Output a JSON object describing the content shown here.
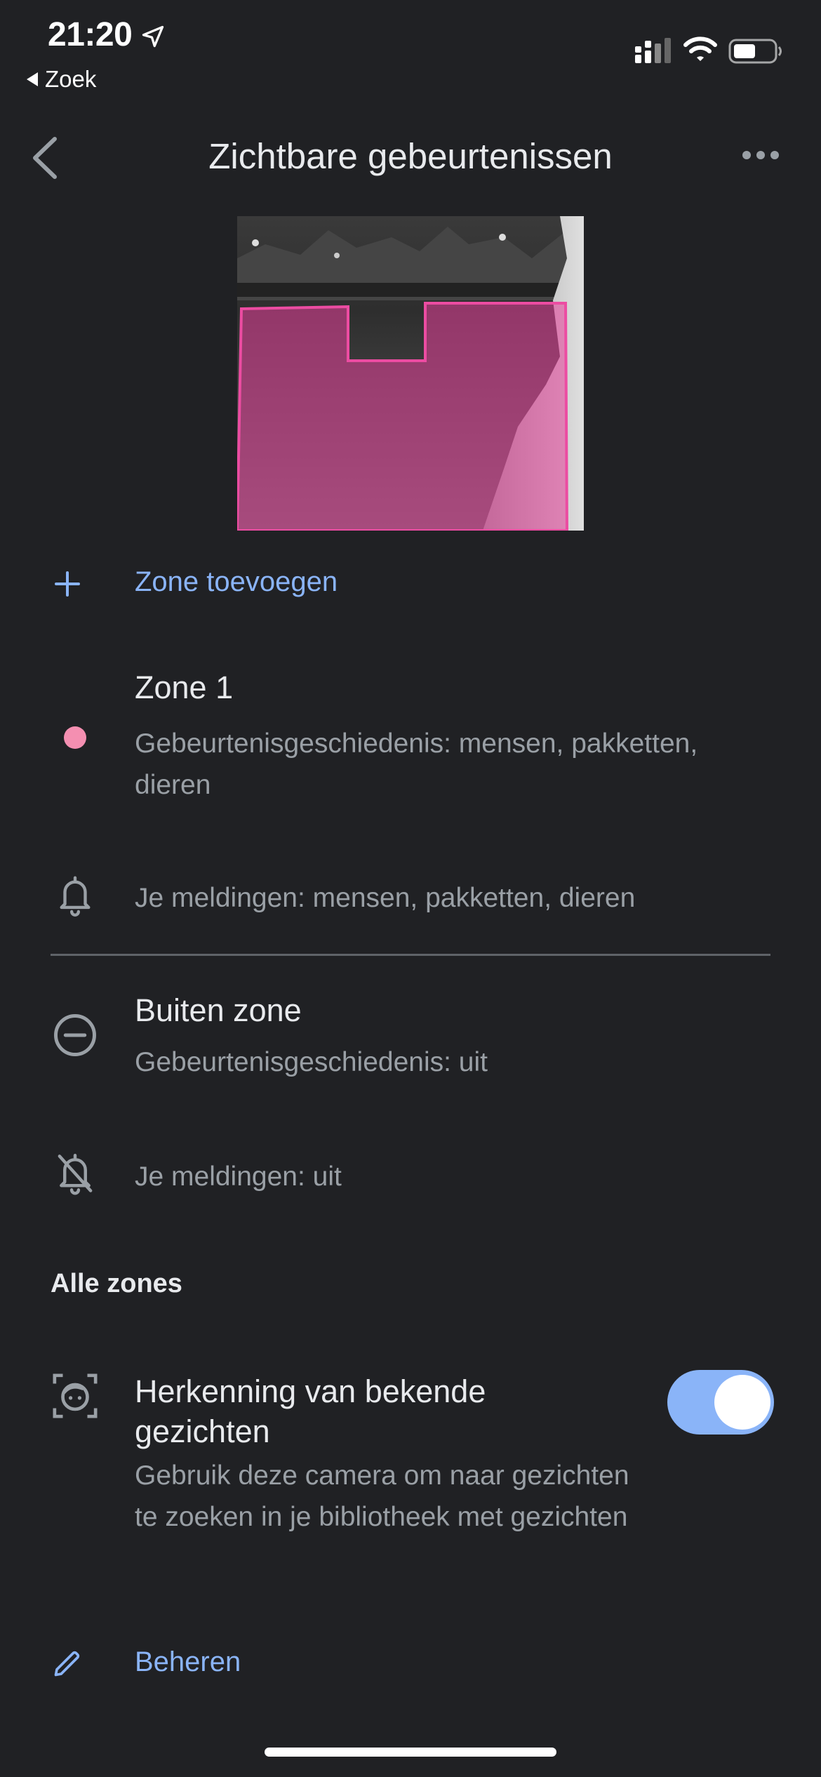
{
  "status_bar": {
    "time": "21:20",
    "back_label": "Zoek"
  },
  "header": {
    "title": "Zichtbare gebeurtenissen"
  },
  "actions": {
    "add_zone": "Zone toevoegen",
    "manage": "Beheren"
  },
  "zones": [
    {
      "name": "Zone 1",
      "history": "Gebeurtenisgeschiedenis: mensen, pakketten, dieren",
      "notifications": "Je meldingen: mensen, pakketten, dieren",
      "color": "#f48fb1"
    },
    {
      "name": "Buiten zone",
      "history": "Gebeurtenisgeschiedenis: uit",
      "notifications": "Je meldingen: uit"
    }
  ],
  "all_zones": {
    "section_title": "Alle zones",
    "face_recognition": {
      "title": "Herkenning van bekende gezichten",
      "description": "Gebruik deze camera om naar gezichten te zoeken in je bibliotheek met gezichten",
      "enabled": true
    }
  },
  "colors": {
    "background": "#202124",
    "accent": "#8ab4f8",
    "zone_pink": "#e8409a",
    "text_secondary": "#9aa0a6"
  }
}
